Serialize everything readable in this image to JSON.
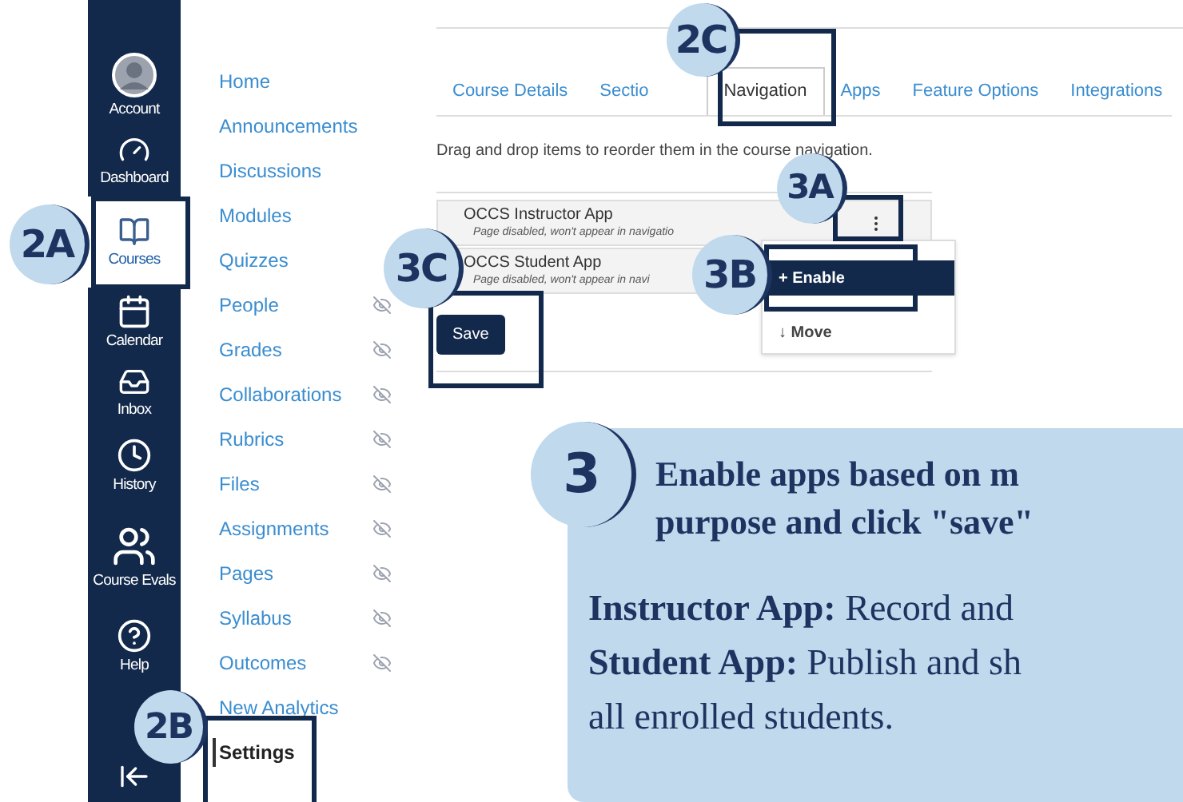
{
  "global_nav": [
    {
      "label": "Account",
      "selected": false
    },
    {
      "label": "Dashboard",
      "selected": false
    },
    {
      "label": "Courses",
      "selected": true
    },
    {
      "label": "Calendar",
      "selected": false
    },
    {
      "label": "Inbox",
      "selected": false
    },
    {
      "label": "History",
      "selected": false
    },
    {
      "label": "Course Evals",
      "selected": false
    },
    {
      "label": "Help",
      "selected": false
    }
  ],
  "course_nav": [
    {
      "label": "Home",
      "hidden": false,
      "selected": false
    },
    {
      "label": "Announcements",
      "hidden": false,
      "selected": false
    },
    {
      "label": "Discussions",
      "hidden": false,
      "selected": false
    },
    {
      "label": "Modules",
      "hidden": false,
      "selected": false
    },
    {
      "label": "Quizzes",
      "hidden": false,
      "selected": false
    },
    {
      "label": "People",
      "hidden": true,
      "selected": false
    },
    {
      "label": "Grades",
      "hidden": true,
      "selected": false
    },
    {
      "label": "Collaborations",
      "hidden": true,
      "selected": false
    },
    {
      "label": "Rubrics",
      "hidden": true,
      "selected": false
    },
    {
      "label": "Files",
      "hidden": true,
      "selected": false
    },
    {
      "label": "Assignments",
      "hidden": true,
      "selected": false
    },
    {
      "label": "Pages",
      "hidden": true,
      "selected": false
    },
    {
      "label": "Syllabus",
      "hidden": true,
      "selected": false
    },
    {
      "label": "Outcomes",
      "hidden": true,
      "selected": false
    },
    {
      "label": "New Analytics",
      "hidden": false,
      "selected": false
    },
    {
      "label": "Settings",
      "hidden": false,
      "selected": true
    }
  ],
  "tabs": [
    {
      "label": "Course Details",
      "selected": false
    },
    {
      "label": "Sectio",
      "selected": false
    },
    {
      "label": "Navigation",
      "selected": true
    },
    {
      "label": "Apps",
      "selected": false
    },
    {
      "label": "Feature Options",
      "selected": false
    },
    {
      "label": "Integrations",
      "selected": false
    }
  ],
  "instructions": "Drag and drop items to reorder them in the course navigation.",
  "nav_items": [
    {
      "name": "OCCS Instructor App",
      "note": "Page disabled, won't appear in navigatio"
    },
    {
      "name": "OCCS Student App",
      "note": "Page disabled, won't appear in navi"
    }
  ],
  "menu": [
    {
      "label": "+ Enable",
      "selected": true
    },
    {
      "label": "↓ Move",
      "selected": false
    }
  ],
  "save_button": "Save",
  "step_badges": [
    "2A",
    "2B",
    "2C",
    "3A",
    "3B",
    "3C",
    "3"
  ],
  "callout": {
    "heading_lines": [
      "Enable apps based on m",
      "purpose and click \"save\""
    ],
    "body_lines": [
      "**Instructor App:** Record and",
      "**Student App:** Publish and sh",
      "all enrolled students."
    ]
  }
}
